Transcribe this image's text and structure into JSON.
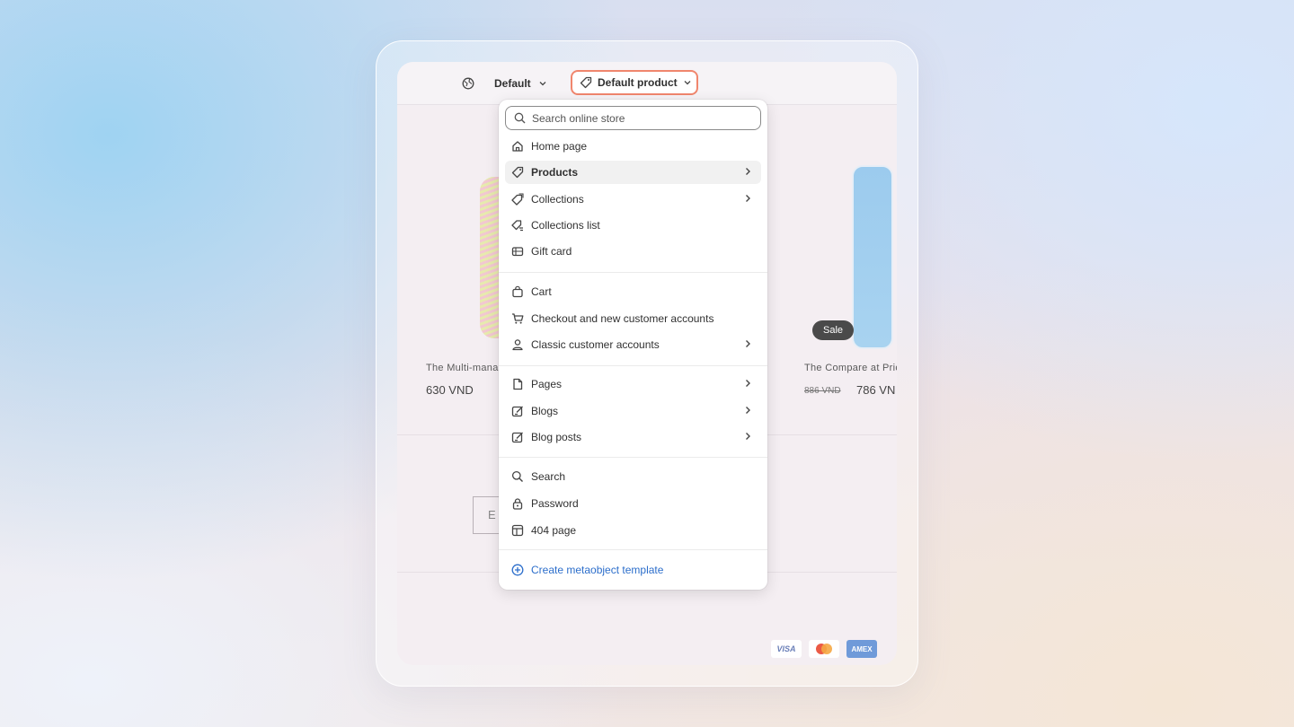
{
  "topbar": {
    "language": "Default",
    "template": "Default product"
  },
  "storefront": {
    "products": [
      {
        "name": "The Multi-mana",
        "price": "630 VND"
      },
      {
        "name": "The Compare at Pric",
        "old_price": "886 VND",
        "price": "786 VN",
        "badge": "Sale"
      }
    ],
    "email_placeholder": "E",
    "payments": [
      "VISA",
      "AMEX"
    ]
  },
  "dropdown": {
    "search_placeholder": "Search online store",
    "groups": [
      [
        {
          "label": "Home page",
          "icon": "home-icon",
          "chevron": false,
          "active": false
        },
        {
          "label": "Products",
          "icon": "tag-icon",
          "chevron": true,
          "active": true
        },
        {
          "label": "Collections",
          "icon": "collection-icon",
          "chevron": true,
          "active": false
        },
        {
          "label": "Collections list",
          "icon": "collection-list-icon",
          "chevron": false,
          "active": false
        },
        {
          "label": "Gift card",
          "icon": "gift-card-icon",
          "chevron": false,
          "active": false
        }
      ],
      [
        {
          "label": "Cart",
          "icon": "cart-bag-icon",
          "chevron": false,
          "active": false
        },
        {
          "label": "Checkout and new customer accounts",
          "icon": "checkout-cart-icon",
          "chevron": false,
          "active": false
        },
        {
          "label": "Classic customer accounts",
          "icon": "person-icon",
          "chevron": true,
          "active": false
        }
      ],
      [
        {
          "label": "Pages",
          "icon": "page-icon",
          "chevron": true,
          "active": false
        },
        {
          "label": "Blogs",
          "icon": "blog-icon",
          "chevron": true,
          "active": false
        },
        {
          "label": "Blog posts",
          "icon": "blog-post-icon",
          "chevron": true,
          "active": false
        }
      ],
      [
        {
          "label": "Search",
          "icon": "search-icon",
          "chevron": false,
          "active": false
        },
        {
          "label": "Password",
          "icon": "lock-icon",
          "chevron": false,
          "active": false
        },
        {
          "label": "404 page",
          "icon": "404-page-icon",
          "chevron": false,
          "active": false
        }
      ]
    ],
    "create_label": "Create metaobject template"
  },
  "colors": {
    "highlight_border": "#f0866d",
    "link": "#2c6ecb",
    "active_bg": "#f1f1f1"
  }
}
